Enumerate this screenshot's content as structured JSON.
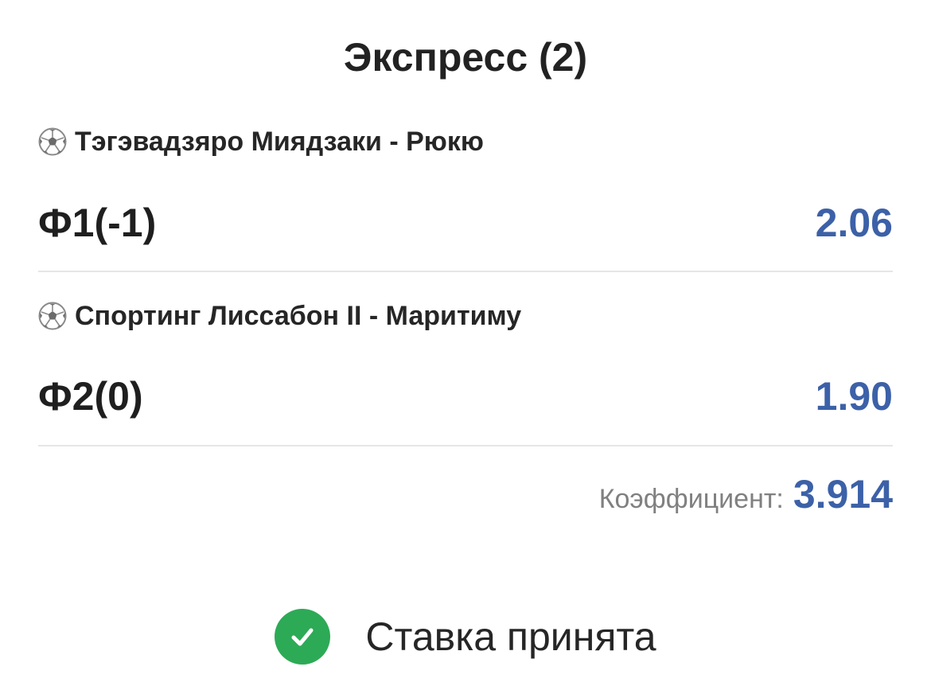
{
  "header": {
    "title": "Экспресс (2)"
  },
  "matches": [
    {
      "sport_icon": "soccer-ball-icon",
      "teams": "Тэгэвадзяро Миядзаки - Рюкю",
      "bet": "Ф1(-1)",
      "odd": "2.06"
    },
    {
      "sport_icon": "soccer-ball-icon",
      "teams": "Спортинг Лиссабон II - Маритиму",
      "bet": "Ф2(0)",
      "odd": "1.90"
    }
  ],
  "total": {
    "label": "Коэффициент:",
    "value": "3.914"
  },
  "status": {
    "icon": "checkmark-icon",
    "text": "Ставка принята"
  },
  "colors": {
    "odds": "#3c61a8",
    "success": "#2daa56",
    "divider": "#e6e6e6",
    "muted": "#808080"
  }
}
